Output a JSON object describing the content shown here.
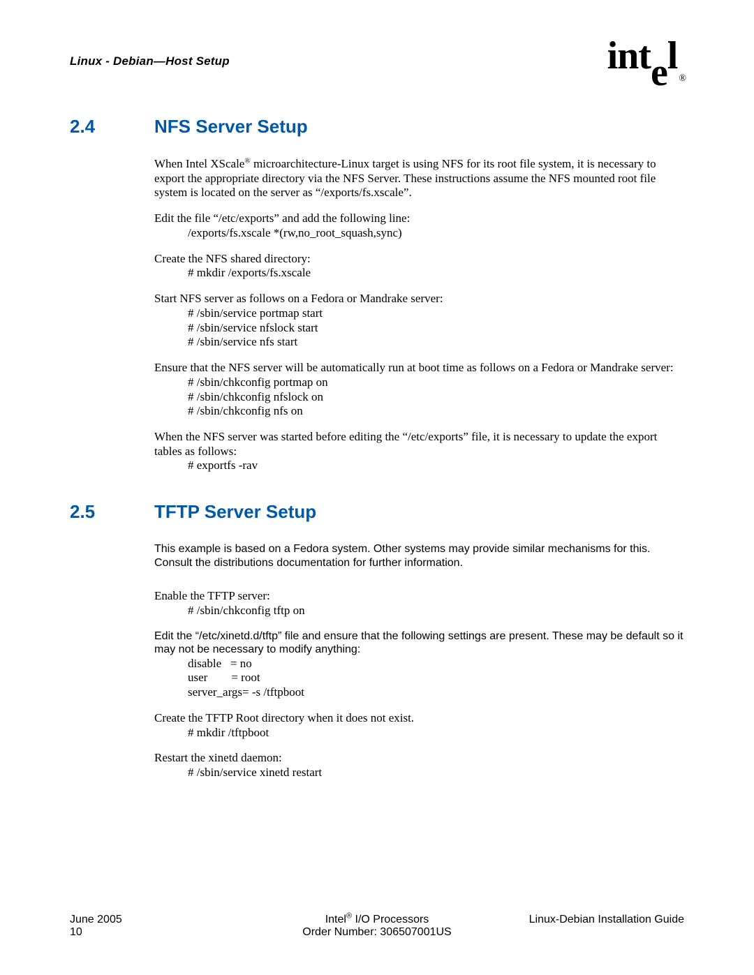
{
  "header": {
    "running": "Linux - Debian—Host Setup",
    "logo_text": "intel",
    "logo_reg": "®"
  },
  "sections": {
    "s24": {
      "num": "2.4",
      "title": "NFS Server Setup",
      "p1a": "When Intel XScale",
      "sup1": "®",
      "p1b": " microarchitecture-Linux target is using NFS for its root file system, it is necessary to export the appropriate directory via the NFS Server. These instructions assume the NFS mounted root file system is located on the server as “/exports/fs.xscale”.",
      "p2": "Edit the file “/etc/exports” and add the following line:",
      "p2_line": "/exports/fs.xscale *(rw,no_root_squash,sync)",
      "p3": "Create the NFS shared directory:",
      "p3_line": "# mkdir /exports/fs.xscale",
      "p4": "Start NFS server as follows on a Fedora or Mandrake server:",
      "p4_l1": "# /sbin/service portmap start",
      "p4_l2": "# /sbin/service nfslock start",
      "p4_l3": "# /sbin/service nfs start",
      "p5": "Ensure that the NFS server will be automatically run at boot time as follows on a Fedora or Mandrake server:",
      "p5_l1": "# /sbin/chkconfig portmap on",
      "p5_l2": "# /sbin/chkconfig nfslock on",
      "p5_l3": "# /sbin/chkconfig nfs on",
      "p6": "When the NFS server was started before editing the “/etc/exports” file, it is necessary to update the export tables as follows:",
      "p6_l1": "# exportfs -rav"
    },
    "s25": {
      "num": "2.5",
      "title": "TFTP Server Setup",
      "p1": "This example is based on a Fedora system. Other systems may provide similar mechanisms for this. Consult the distributions documentation for further information.",
      "p2": "Enable the TFTP server:",
      "p2_l1": "# /sbin/chkconfig tftp on",
      "p3": "Edit the “/etc/xinetd.d/tftp” file and ensure that the following settings are present. These may be default so it may not be necessary to modify anything:",
      "p3_kv": "disable   = no\nuser        = root\nserver_args= -s /tftpboot",
      "p4": "Create the TFTP Root directory when it does not exist.",
      "p4_l1": "# mkdir /tftpboot",
      "p5": "Restart the xinetd daemon:",
      "p5_l1": "# /sbin/service xinetd restart"
    }
  },
  "footer": {
    "left_line1": "June 2005",
    "left_line2": "10",
    "center_a": "Intel",
    "center_sup": "®",
    "center_b": " I/O Processors",
    "center_line2": "Order Number: 306507001US",
    "right_line1": "Linux-Debian Installation Guide"
  }
}
